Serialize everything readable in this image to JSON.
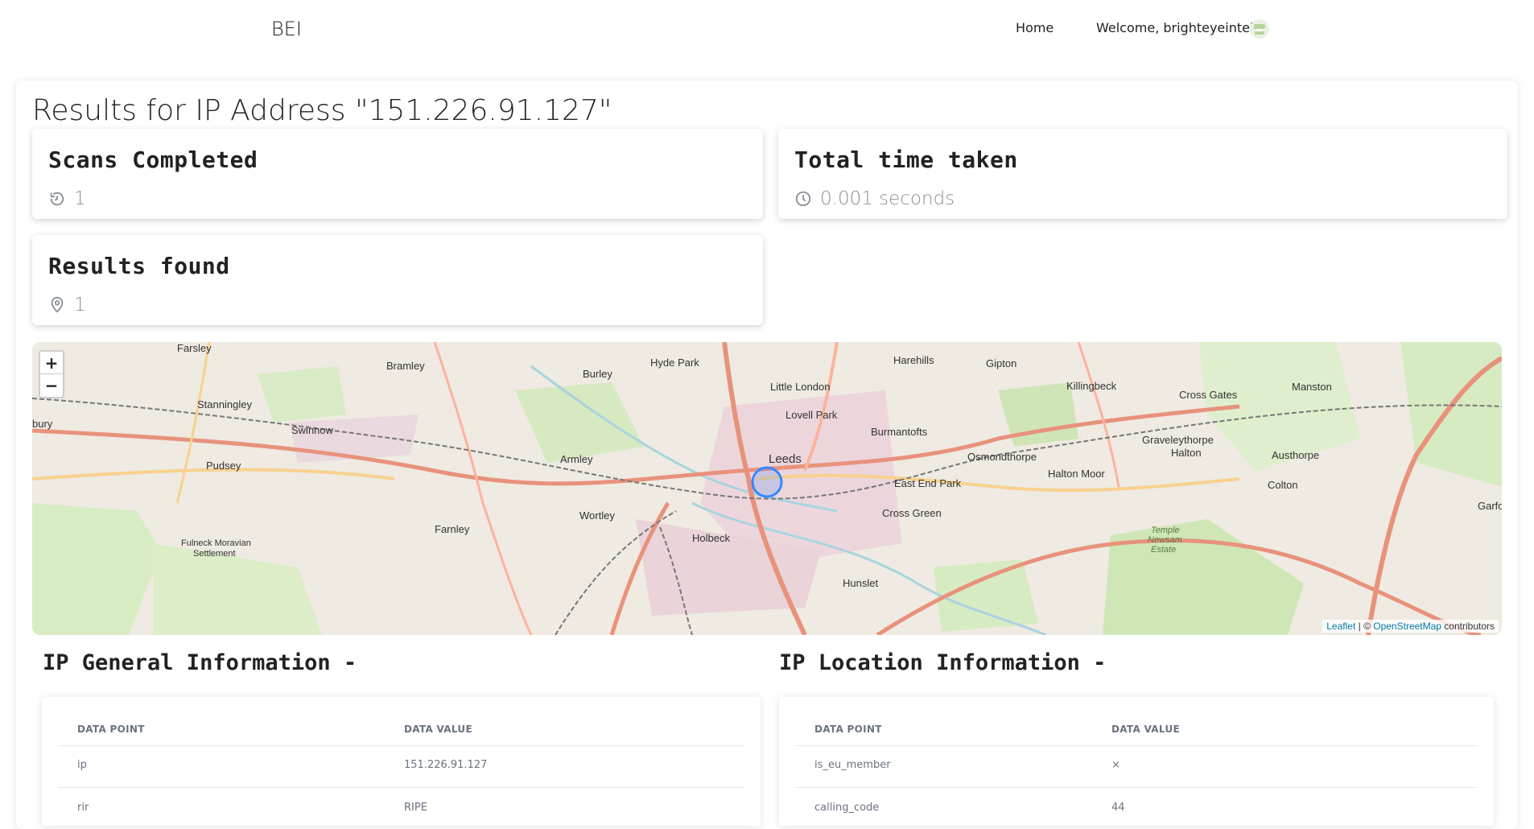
{
  "nav": {
    "brand": "BEI",
    "home": "Home",
    "welcome": "Welcome, brighteyeintel"
  },
  "page": {
    "title": "Results for IP Address \"151.226.91.127\""
  },
  "stats": {
    "scans": {
      "title": "Scans Completed",
      "value": "1",
      "icon": "rotate-icon"
    },
    "time": {
      "title": "Total time taken",
      "value": "0.001 seconds",
      "icon": "clock-icon"
    },
    "results": {
      "title": "Results found",
      "value": "1",
      "icon": "location-pin-icon"
    }
  },
  "map": {
    "zoom_in": "+",
    "zoom_out": "−",
    "attribution_leaflet": "Leaflet",
    "attribution_sep": " | © ",
    "attribution_osm": "OpenStreetMap",
    "attribution_suffix": " contributors",
    "labels": {
      "farsley": "Farsley",
      "bramley": "Bramley",
      "burley": "Burley",
      "hyde_park": "Hyde Park",
      "harehills": "Harehills",
      "gipton": "Gipton",
      "killingbeck": "Killingbeck",
      "cross_gates": "Cross Gates",
      "manston": "Manston",
      "stanningley": "Stanningley",
      "swinnow": "Swinnow",
      "little_london": "Little London",
      "lovell_park": "Lovell Park",
      "burmantofts": "Burmantofts",
      "osmondthorpe": "Osmondthorpe",
      "graveleythorpe": "Graveleythorpe",
      "halton": "Halton",
      "austhorpe": "Austhorpe",
      "pudsey": "Pudsey",
      "armley": "Armley",
      "leeds": "Leeds",
      "east_end_park": "East End Park",
      "halton_moor": "Halton Moor",
      "colton": "Colton",
      "wortley": "Wortley",
      "cross_green": "Cross Green",
      "farnley": "Farnley",
      "holbeck": "Holbeck",
      "fulneck": "Fulneck Moravian",
      "settlement": "Settlement",
      "hunslet": "Hunslet",
      "garforth": "Garfo",
      "bury": "bury",
      "temple": "Temple",
      "newsam": "Newsam",
      "estate": "Estate"
    }
  },
  "ip_general": {
    "title": "IP General Information -",
    "headers": [
      "DATA POINT",
      "DATA VALUE"
    ],
    "rows": [
      {
        "point": "ip",
        "value": "151.226.91.127"
      },
      {
        "point": "rir",
        "value": "RIPE"
      }
    ]
  },
  "ip_location": {
    "title": "IP Location Information -",
    "headers": [
      "DATA POINT",
      "DATA VALUE"
    ],
    "rows": [
      {
        "point": "is_eu_member",
        "value": "×"
      },
      {
        "point": "calling_code",
        "value": "44"
      }
    ]
  }
}
